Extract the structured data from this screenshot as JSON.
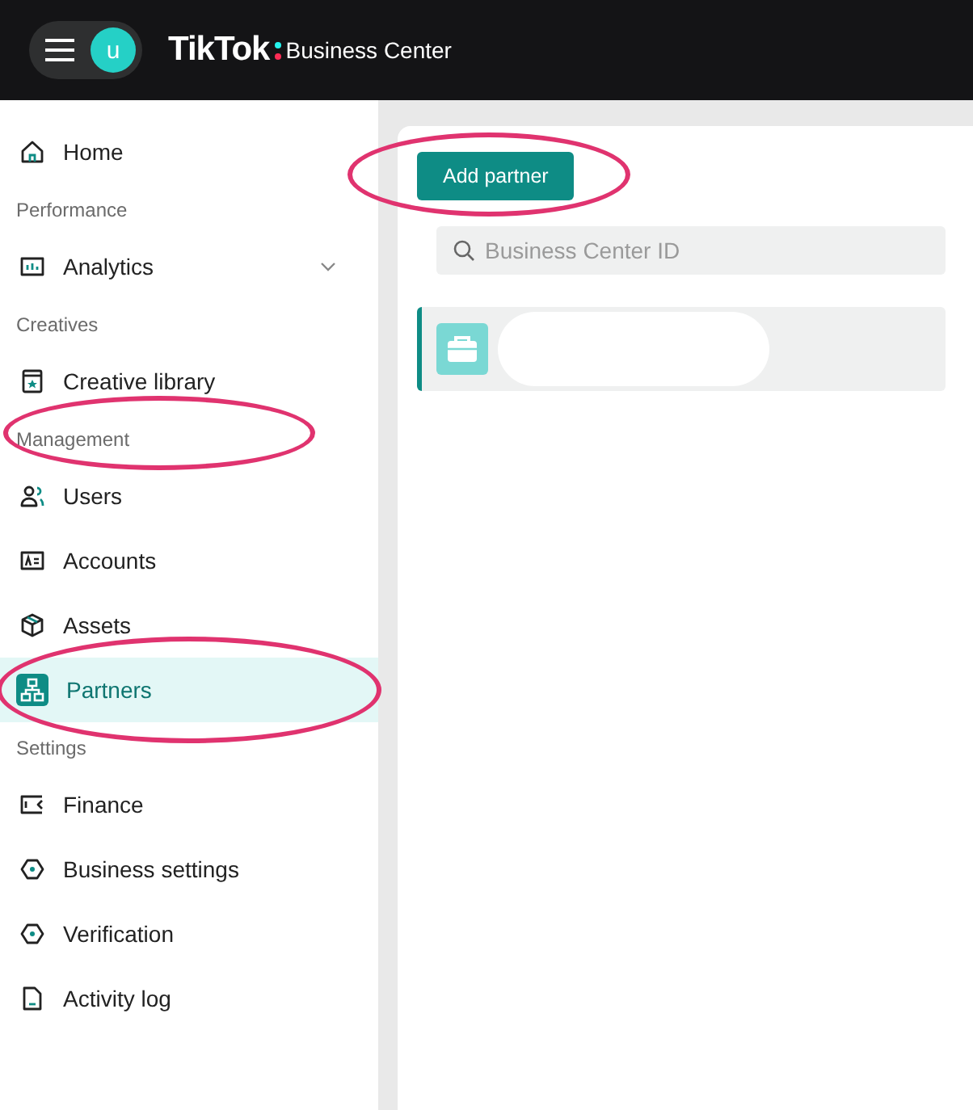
{
  "header": {
    "logo": "TikTok",
    "product": "Business Center",
    "avatar_initial": "u"
  },
  "sidebar": {
    "entries": [
      {
        "kind": "item",
        "label": "Home",
        "selected": false,
        "has_submenu": false,
        "circled": false
      },
      {
        "kind": "section",
        "label": "Performance",
        "circled": false
      },
      {
        "kind": "item",
        "label": "Analytics",
        "selected": false,
        "has_submenu": true,
        "circled": false
      },
      {
        "kind": "section",
        "label": "Creatives",
        "circled": false
      },
      {
        "kind": "item",
        "label": "Creative library",
        "selected": false,
        "has_submenu": false,
        "circled": false
      },
      {
        "kind": "section",
        "label": "Management",
        "circled": true
      },
      {
        "kind": "item",
        "label": "Users",
        "selected": false,
        "has_submenu": false,
        "circled": false
      },
      {
        "kind": "item",
        "label": "Accounts",
        "selected": false,
        "has_submenu": false,
        "circled": false
      },
      {
        "kind": "item",
        "label": "Assets",
        "selected": false,
        "has_submenu": false,
        "circled": false
      },
      {
        "kind": "item",
        "label": "Partners",
        "selected": true,
        "has_submenu": false,
        "circled": true
      },
      {
        "kind": "section",
        "label": "Settings",
        "circled": false
      },
      {
        "kind": "item",
        "label": "Finance",
        "selected": false,
        "has_submenu": false,
        "circled": false
      },
      {
        "kind": "item",
        "label": "Business settings",
        "selected": false,
        "has_submenu": false,
        "circled": false
      },
      {
        "kind": "item",
        "label": "Verification",
        "selected": false,
        "has_submenu": false,
        "circled": false
      },
      {
        "kind": "item",
        "label": "Activity log",
        "selected": false,
        "has_submenu": false,
        "circled": false
      }
    ]
  },
  "content": {
    "add_button": {
      "label": "Add partner",
      "circled": true
    },
    "search": {
      "placeholder": "Business Center ID"
    },
    "partners": [
      {
        "selected": true
      }
    ]
  }
}
